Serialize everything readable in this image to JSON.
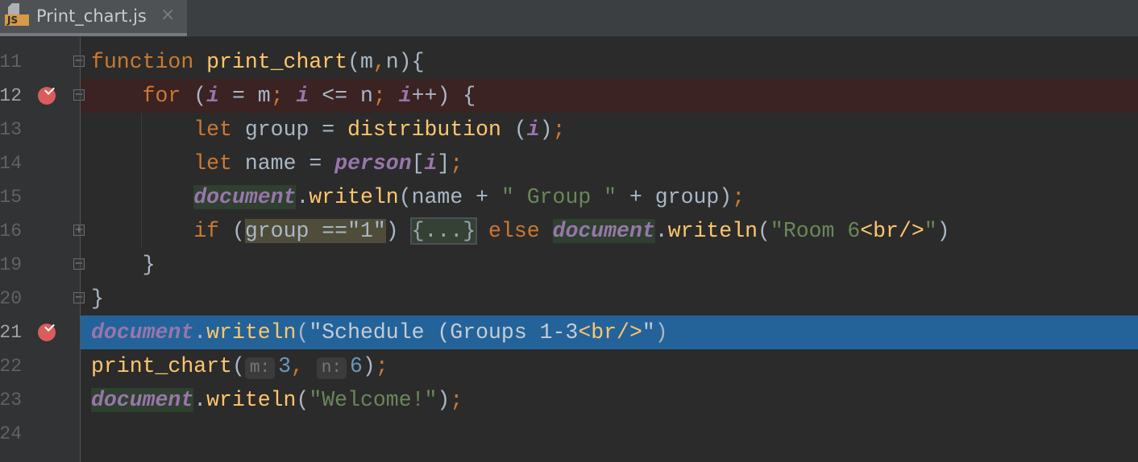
{
  "tab": {
    "title": "Print_chart.js",
    "icon_label": "JS",
    "close": "×"
  },
  "lines": [
    {
      "num": "11",
      "bp": false,
      "exec": false,
      "fold": "−",
      "tokens": [
        [
          "kw",
          "function "
        ],
        [
          "fn",
          "print_chart"
        ],
        [
          "",
          "(m"
        ],
        [
          "kw",
          ","
        ],
        [
          "",
          "n){"
        ]
      ]
    },
    {
      "num": "12",
      "bp": true,
      "exec": false,
      "fold": "−",
      "tokens": [
        [
          "",
          "    "
        ],
        [
          "kw",
          "for "
        ],
        [
          "",
          "("
        ],
        [
          "var",
          "i"
        ],
        [
          "",
          " = m"
        ],
        [
          "kw",
          "; "
        ],
        [
          "var",
          "i"
        ],
        [
          "",
          " <= n"
        ],
        [
          "kw",
          "; "
        ],
        [
          "var",
          "i"
        ],
        [
          "",
          "++) {"
        ]
      ]
    },
    {
      "num": "13",
      "bp": false,
      "exec": false,
      "fold": "",
      "tokens": [
        [
          "",
          "        "
        ],
        [
          "kw",
          "let "
        ],
        [
          "",
          "group = "
        ],
        [
          "fn",
          "distribution"
        ],
        [
          "",
          " ("
        ],
        [
          "var",
          "i"
        ],
        [
          "",
          ")"
        ],
        [
          "kw",
          ";"
        ]
      ]
    },
    {
      "num": "14",
      "bp": false,
      "exec": false,
      "fold": "",
      "tokens": [
        [
          "",
          "        "
        ],
        [
          "kw",
          "let "
        ],
        [
          "",
          "name = "
        ],
        [
          "var",
          "person"
        ],
        [
          "",
          "["
        ],
        [
          "var",
          "i"
        ],
        [
          "",
          "]"
        ],
        [
          "kw",
          ";"
        ]
      ]
    },
    {
      "num": "15",
      "bp": false,
      "exec": false,
      "fold": "",
      "tokens": [
        [
          "",
          "        "
        ],
        [
          "glob",
          "document"
        ],
        [
          "",
          "."
        ],
        [
          "fn",
          "writeln"
        ],
        [
          "",
          "(name + "
        ],
        [
          "str",
          "\" Group \""
        ],
        [
          "",
          " + group)"
        ],
        [
          "kw",
          ";"
        ]
      ]
    },
    {
      "num": "16",
      "bp": false,
      "exec": false,
      "fold": "+",
      "tokens": [
        [
          "",
          "        "
        ],
        [
          "kw",
          "if "
        ],
        [
          "",
          "("
        ],
        [
          "hl",
          "group ==\"1\""
        ],
        [
          "",
          ") "
        ],
        [
          "folded",
          "{...}"
        ],
        [
          "kw",
          " else "
        ],
        [
          "glob",
          "document"
        ],
        [
          "",
          "."
        ],
        [
          "fn",
          "writeln"
        ],
        [
          "",
          "("
        ],
        [
          "str",
          "\"Room 6"
        ],
        [
          "fn",
          "<br/>"
        ],
        [
          "str",
          "\""
        ],
        [
          "",
          ")"
        ]
      ]
    },
    {
      "num": "19",
      "bp": false,
      "exec": false,
      "fold": "−",
      "tokens": [
        [
          "",
          "    }"
        ]
      ]
    },
    {
      "num": "20",
      "bp": false,
      "exec": false,
      "fold": "−",
      "tokens": [
        [
          "",
          "}"
        ]
      ]
    },
    {
      "num": "21",
      "bp": true,
      "exec": true,
      "fold": "",
      "tokens": [
        [
          "glob",
          "document"
        ],
        [
          "",
          "."
        ],
        [
          "fn",
          "writeln"
        ],
        [
          "",
          "("
        ],
        [
          "str",
          "\"Schedule (Groups 1-3"
        ],
        [
          "fn",
          "<br/>"
        ],
        [
          "str",
          "\""
        ],
        [
          "",
          ")"
        ]
      ]
    },
    {
      "num": "22",
      "bp": false,
      "exec": false,
      "fold": "",
      "tokens": [
        [
          "fn",
          "print_chart"
        ],
        [
          "",
          "("
        ],
        [
          "hint",
          "m:"
        ],
        [
          "num",
          "3"
        ],
        [
          "kw",
          ", "
        ],
        [
          "hint",
          "n:"
        ],
        [
          "num",
          "6"
        ],
        [
          "",
          ")"
        ],
        [
          "kw",
          ";"
        ]
      ]
    },
    {
      "num": "23",
      "bp": false,
      "exec": false,
      "fold": "",
      "tokens": [
        [
          "glob",
          "document"
        ],
        [
          "",
          "."
        ],
        [
          "fn",
          "writeln"
        ],
        [
          "",
          "("
        ],
        [
          "str",
          "\"Welcome!\""
        ],
        [
          "",
          ")"
        ],
        [
          "kw",
          ";"
        ]
      ]
    },
    {
      "num": "24",
      "bp": false,
      "exec": false,
      "fold": "",
      "tokens": []
    }
  ]
}
